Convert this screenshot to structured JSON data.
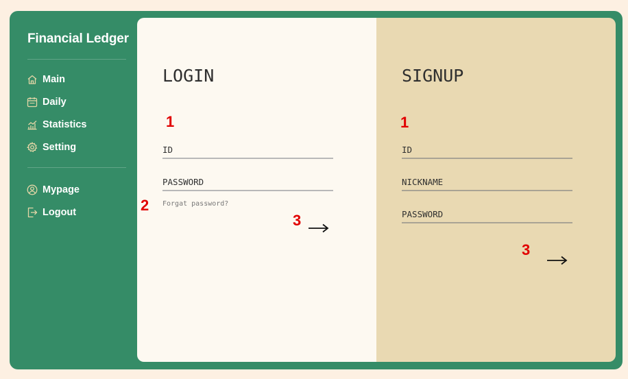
{
  "app": {
    "title": "Financial Ledger"
  },
  "sidebar": {
    "items": [
      {
        "label": "Main",
        "icon": "home-icon"
      },
      {
        "label": "Daily",
        "icon": "calendar-icon"
      },
      {
        "label": "Statistics",
        "icon": "chart-icon"
      },
      {
        "label": "Setting",
        "icon": "gear-icon"
      }
    ],
    "bottom_items": [
      {
        "label": "Mypage",
        "icon": "user-icon"
      },
      {
        "label": "Logout",
        "icon": "logout-icon"
      }
    ]
  },
  "login": {
    "title": "LOGIN",
    "id_placeholder": "ID",
    "password_placeholder": "PASSWORD",
    "forgot_label": "Forgat password?",
    "submit_icon": "arrow-right-icon"
  },
  "signup": {
    "title": "SIGNUP",
    "id_placeholder": "ID",
    "nickname_placeholder": "NICKNAME",
    "password_placeholder": "PASSWORD",
    "submit_icon": "arrow-right-icon"
  },
  "annotations": {
    "login_fields": "1",
    "login_forgot": "2",
    "login_submit": "3",
    "signup_fields": "1",
    "signup_submit": "3",
    "color": "#e10000"
  },
  "colors": {
    "page_bg": "#fdf0e2",
    "sidebar_green": "#358c67",
    "login_bg": "#fdf9f1",
    "signup_bg": "#e9d9b2",
    "icon_stroke": "#e4d6a7"
  }
}
